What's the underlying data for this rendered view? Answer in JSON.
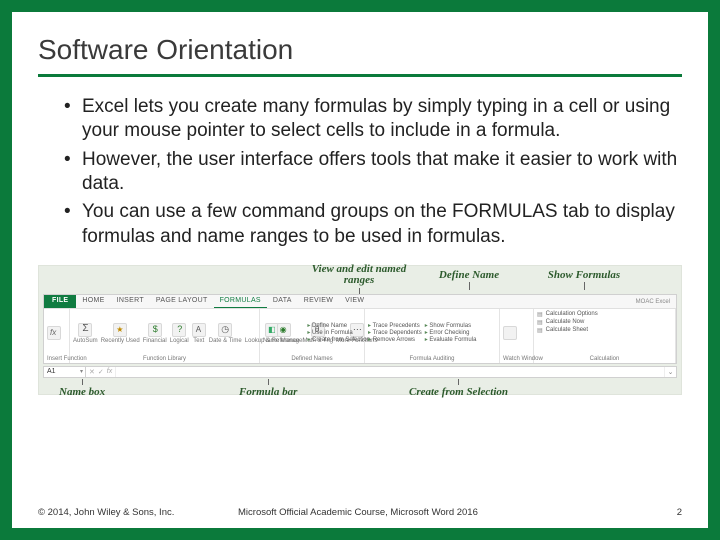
{
  "title": "Software Orientation",
  "bullets": [
    "Excel lets you create many formulas by simply typing in a cell or using your mouse pointer to select cells to include in a formula.",
    "However, the user interface offers tools that make it easier to work with data.",
    "You can use a few command groups on the FORMULAS tab to display formulas and name ranges to be used in formulas."
  ],
  "callouts": {
    "view_edit": "View and edit named ranges",
    "define": "Define Name",
    "show": "Show Formulas",
    "namebox": "Name box",
    "formulabar": "Formula bar",
    "create_sel": "Create from Selection"
  },
  "ribbon": {
    "tabs": {
      "file": "FILE",
      "home": "HOME",
      "insert": "INSERT",
      "page": "PAGE LAYOUT",
      "formulas": "FORMULAS",
      "data": "DATA",
      "review": "REVIEW",
      "view": "VIEW"
    },
    "groups": {
      "insert_fn": "Insert Function",
      "autosum": "AutoSum",
      "recent": "Recently Used",
      "financial": "Financial",
      "logical": "Logical",
      "text": "Text",
      "datetime": "Date & Time",
      "lookup": "Lookup & Reference",
      "math": "Math & Trig",
      "more": "More Functions",
      "library": "Function Library",
      "name_mgr": "Name Manager",
      "def_names": "Defined Names",
      "define_name": "Define Name",
      "use_in": "Use in Formula",
      "create_from": "Create from Selection",
      "trace_prec": "Trace Precedents",
      "trace_dep": "Trace Dependents",
      "remove_arr": "Remove Arrows",
      "show_form": "Show Formulas",
      "err_check": "Error Checking",
      "eval": "Evaluate Formula",
      "audit": "Formula Auditing",
      "watch": "Watch Window",
      "calc_opts": "Calculation Options",
      "calc_now": "Calculate Now",
      "calc_sheet": "Calculate Sheet",
      "calc": "Calculation"
    },
    "namebox_value": "A1",
    "title_right": "MOAC Excel"
  },
  "footer": {
    "copyright": "© 2014, John Wiley & Sons, Inc.",
    "course": "Microsoft Official Academic Course, Microsoft Word 2016",
    "page": "2"
  }
}
